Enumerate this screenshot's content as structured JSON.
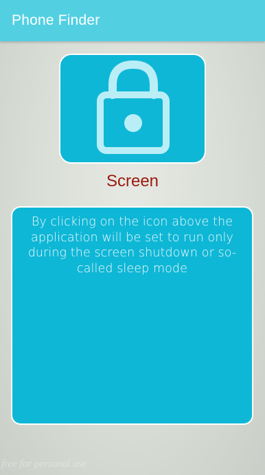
{
  "app_bar": {
    "title": "Phone Finder",
    "background_color": "#52d0e2"
  },
  "lock_button": {
    "icon": "lock-icon",
    "tile_color": "#0fb7d6",
    "icon_color": "#b9eef7"
  },
  "caption": {
    "text": "Screen",
    "color": "#9a1a10"
  },
  "info": {
    "text": "By clicking on the icon above the application will be set to run only during the screen shutdown or so-called sleep mode"
  },
  "watermark": {
    "text": "free for personal use"
  }
}
